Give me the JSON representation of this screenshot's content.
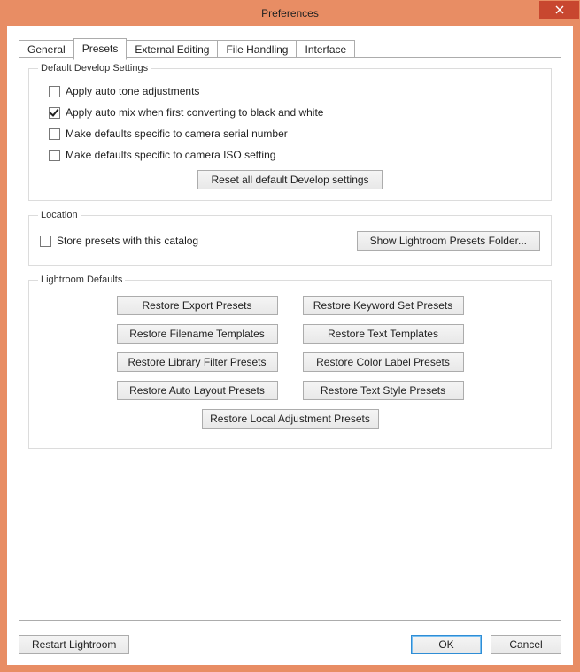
{
  "window": {
    "title": "Preferences"
  },
  "tabs": {
    "general": "General",
    "presets": "Presets",
    "external": "External Editing",
    "file": "File Handling",
    "interface": "Interface",
    "active": "presets"
  },
  "groups": {
    "develop": {
      "legend": "Default Develop Settings",
      "apply_auto_tone": {
        "label": "Apply auto tone adjustments",
        "checked": false
      },
      "apply_auto_mix": {
        "label": "Apply auto mix when first converting to black and white",
        "checked": true
      },
      "defaults_serial": {
        "label": "Make defaults specific to camera serial number",
        "checked": false
      },
      "defaults_iso": {
        "label": "Make defaults specific to camera ISO setting",
        "checked": false
      },
      "reset_btn": "Reset all default Develop settings"
    },
    "location": {
      "legend": "Location",
      "store_with_catalog": {
        "label": "Store presets with this catalog",
        "checked": false
      },
      "show_folder_btn": "Show Lightroom Presets Folder..."
    },
    "defaults": {
      "legend": "Lightroom Defaults",
      "restore_export": "Restore Export Presets",
      "restore_keyword": "Restore Keyword Set Presets",
      "restore_filename": "Restore Filename Templates",
      "restore_text": "Restore Text Templates",
      "restore_library": "Restore Library Filter Presets",
      "restore_color": "Restore Color Label Presets",
      "restore_autolayout": "Restore Auto Layout Presets",
      "restore_textstyle": "Restore Text Style Presets",
      "restore_local": "Restore Local Adjustment Presets"
    }
  },
  "footer": {
    "restart": "Restart Lightroom",
    "ok": "OK",
    "cancel": "Cancel"
  }
}
